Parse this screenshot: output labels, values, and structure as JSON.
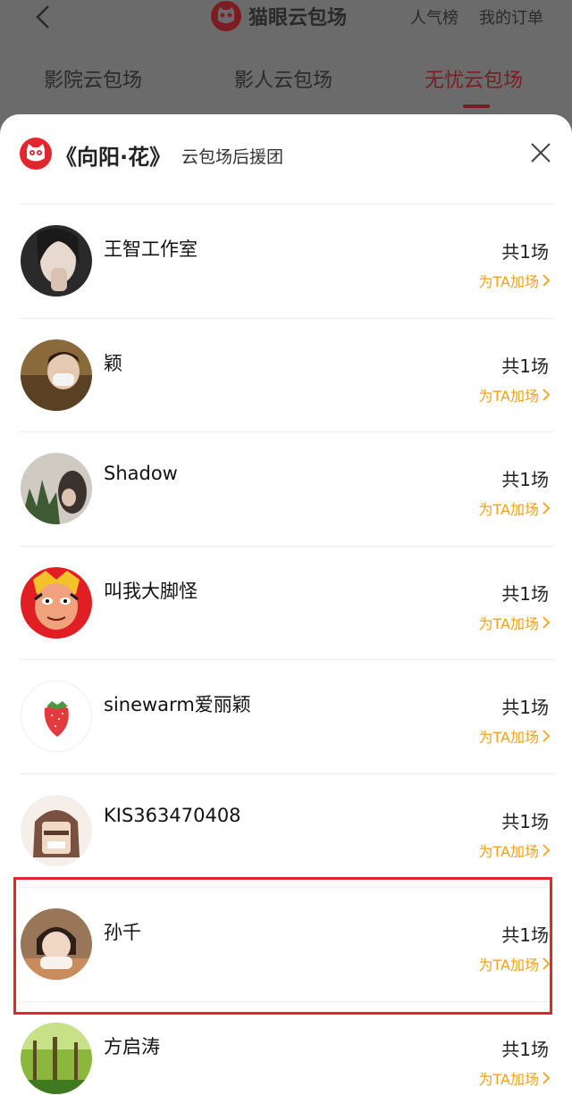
{
  "header": {
    "title": "猫眼云包场",
    "link_rank": "人气榜",
    "link_orders": "我的订单",
    "icons": {
      "back": "back-arrow-icon",
      "logo": "maoyan-cat-logo"
    }
  },
  "tabs": [
    {
      "label": "影院云包场",
      "active": false
    },
    {
      "label": "影人云包场",
      "active": false
    },
    {
      "label": "无忧云包场",
      "active": true
    }
  ],
  "sheet": {
    "title": "《向阳·花》",
    "subtitle": "云包场后援团",
    "close_icon": "close-icon"
  },
  "supporters": [
    {
      "name": "王智工作室",
      "count": "共1场",
      "action": "为TA加场",
      "avatar": "woman-portrait"
    },
    {
      "name": "颖",
      "count": "共1场",
      "action": "为TA加场",
      "avatar": "masked-woman"
    },
    {
      "name": "Shadow",
      "count": "共1场",
      "action": "为TA加场",
      "avatar": "plants-and-person"
    },
    {
      "name": "叫我大脚怪",
      "count": "共1场",
      "action": "为TA加场",
      "avatar": "monkey-king-mask"
    },
    {
      "name": "sinewarm爱丽颖",
      "count": "共1场",
      "action": "为TA加场",
      "avatar": "strawberry"
    },
    {
      "name": "KIS363470408",
      "count": "共1场",
      "action": "为TA加场",
      "avatar": "cartoon-man"
    },
    {
      "name": "孙千",
      "count": "共1场",
      "action": "为TA加场",
      "avatar": "girl-portrait",
      "highlighted": true
    },
    {
      "name": "方启涛",
      "count": "共1场",
      "action": "为TA加场",
      "avatar": "forest"
    }
  ],
  "colors": {
    "accent_red": "#e2262f",
    "action_orange": "#f0a21c",
    "active_tab": "#7d1c22",
    "overlay": "#6b6b6b"
  }
}
